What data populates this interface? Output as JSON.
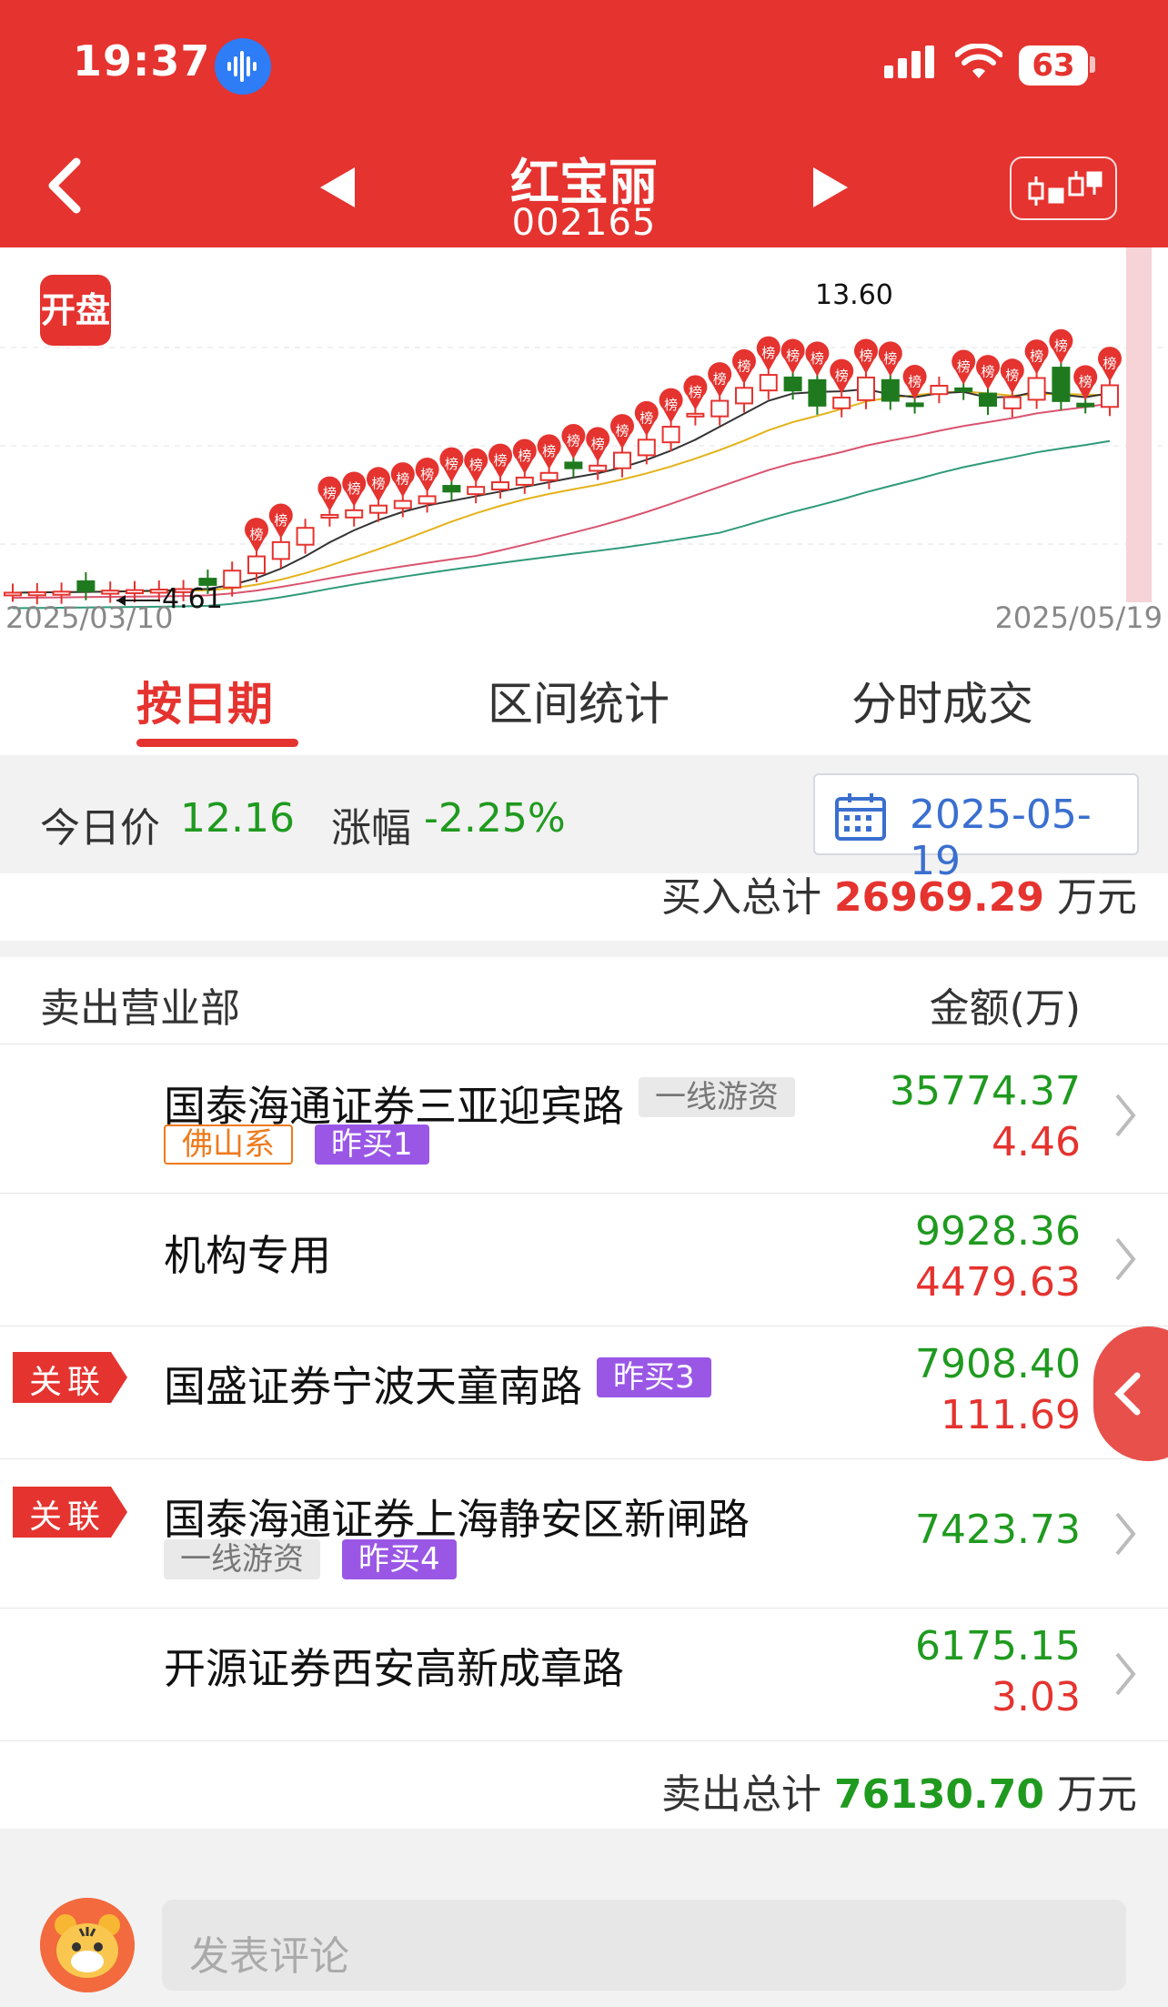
{
  "status_bar": {
    "time": "19:37",
    "battery": "63"
  },
  "header": {
    "title": "红宝丽",
    "code": "002165"
  },
  "chart": {
    "badge": "开盘",
    "marker_high": "13.60",
    "marker_low": "4.61",
    "date_start": "2025/03/10",
    "date_end": "2025/05/19",
    "rank_label": "榜"
  },
  "tabs": [
    {
      "label": "按日期",
      "active": true
    },
    {
      "label": "区间统计",
      "active": false
    },
    {
      "label": "分时成交",
      "active": false
    }
  ],
  "price_bar": {
    "today_label": "今日价",
    "today_value": "12.16",
    "change_label": "涨幅",
    "change_value": "-2.25%",
    "date": "2025-05-19"
  },
  "buy_total": {
    "label": "买入总计",
    "value": "26969.29",
    "unit": "万元"
  },
  "sell_table": {
    "header_left": "卖出营业部",
    "header_right": "金额(万)",
    "rows": [
      {
        "name": "国泰海通证券三亚迎宾路",
        "tags": [
          "一线游资",
          "佛山系",
          "昨买1"
        ],
        "sell": "35774.37",
        "buy": "4.46",
        "assoc": ""
      },
      {
        "name": "机构专用",
        "tags": [],
        "sell": "9928.36",
        "buy": "4479.63",
        "assoc": ""
      },
      {
        "name": "国盛证券宁波天童南路",
        "tags": [
          "昨买3"
        ],
        "sell": "7908.40",
        "buy": "111.69",
        "assoc": "关联"
      },
      {
        "name": "国泰海通证券上海静安区新闸路",
        "tags": [
          "一线游资",
          "昨买4"
        ],
        "sell": "7423.73",
        "buy": "",
        "assoc": "关联"
      },
      {
        "name": "开源证券西安高新成章路",
        "tags": [],
        "sell": "6175.15",
        "buy": "3.03",
        "assoc": ""
      }
    ]
  },
  "sell_total": {
    "label": "卖出总计",
    "value": "76130.70",
    "unit": "万元"
  },
  "comment": {
    "placeholder": "发表评论"
  },
  "colors": {
    "brand_red": "#e5332f",
    "green": "#1f9a1f",
    "purple_tag": "#9a57e6",
    "orange_tag": "#ee7a1c",
    "date_blue": "#3a6fcf"
  }
}
